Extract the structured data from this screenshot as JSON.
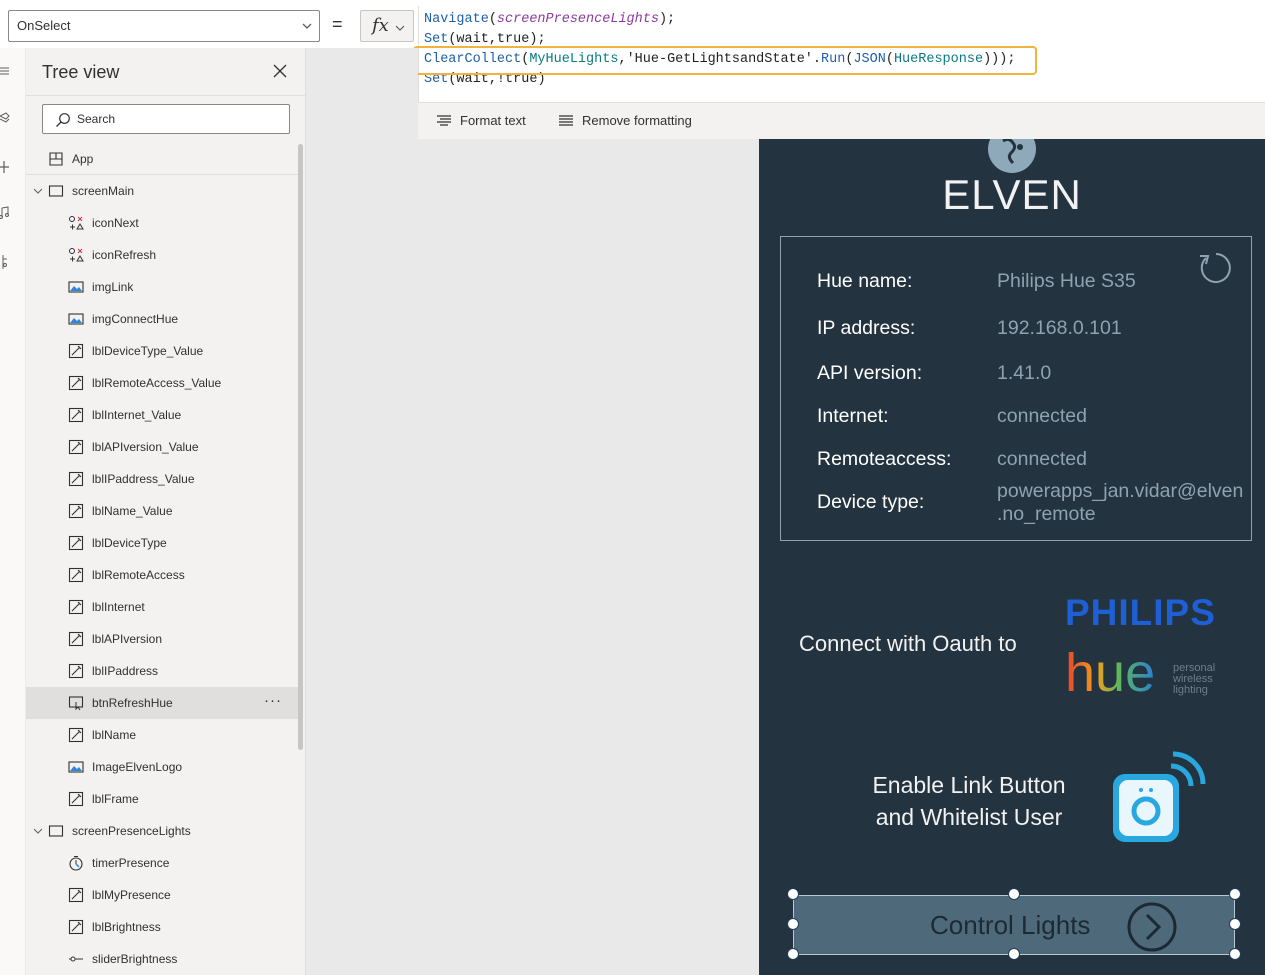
{
  "property_select": {
    "value": "OnSelect"
  },
  "equals": "=",
  "fx_label": "fx",
  "formula": {
    "lines": [
      "Navigate(screenPresenceLights);",
      "Set(wait,true);",
      "ClearCollect(MyHueLights,'Hue-GetLightsandState'.Run(JSON(HueResponse)));",
      "Set(wait,!true)"
    ],
    "line1": {
      "fn": "Navigate",
      "open": "(",
      "arg": "screenPresenceLights",
      "close": ");"
    },
    "line2": {
      "fn": "Set",
      "open": "(",
      "arg": "wait,true",
      "close": ");"
    },
    "line3": {
      "fn": "ClearCollect",
      "open": "(",
      "arg1": "MyHueLights",
      "sep": ",",
      "str": "'Hue-GetLightsandState'",
      "dot": ".",
      "fn2": "Run",
      "open2": "(",
      "fn3": "JSON",
      "open3": "(",
      "arg2": "HueResponse",
      "close": ")));"
    },
    "line4": {
      "fn": "Set",
      "open": "(",
      "arg": "wait,!true",
      "close": ")"
    }
  },
  "format_bar": {
    "format_text": "Format text",
    "remove_formatting": "Remove formatting"
  },
  "tree_view": {
    "title": "Tree view",
    "search_placeholder": "Search",
    "items": [
      {
        "label": "App",
        "icon": "app-icon",
        "level": 0
      },
      {
        "label": "screenMain",
        "icon": "screen-icon",
        "level": 0,
        "expanded": true
      },
      {
        "label": "iconNext",
        "icon": "icon-control-icon",
        "level": 1
      },
      {
        "label": "iconRefresh",
        "icon": "icon-control-icon",
        "level": 1
      },
      {
        "label": "imgLink",
        "icon": "image-icon",
        "level": 1
      },
      {
        "label": "imgConnectHue",
        "icon": "image-icon",
        "level": 1
      },
      {
        "label": "lblDeviceType_Value",
        "icon": "label-icon",
        "level": 1
      },
      {
        "label": "lblRemoteAccess_Value",
        "icon": "label-icon",
        "level": 1
      },
      {
        "label": "lblInternet_Value",
        "icon": "label-icon",
        "level": 1
      },
      {
        "label": "lblAPIversion_Value",
        "icon": "label-icon",
        "level": 1
      },
      {
        "label": "lblIPaddress_Value",
        "icon": "label-icon",
        "level": 1
      },
      {
        "label": "lblName_Value",
        "icon": "label-icon",
        "level": 1
      },
      {
        "label": "lblDeviceType",
        "icon": "label-icon",
        "level": 1
      },
      {
        "label": "lblRemoteAccess",
        "icon": "label-icon",
        "level": 1
      },
      {
        "label": "lblInternet",
        "icon": "label-icon",
        "level": 1
      },
      {
        "label": "lblAPIversion",
        "icon": "label-icon",
        "level": 1
      },
      {
        "label": "lblIPaddress",
        "icon": "label-icon",
        "level": 1
      },
      {
        "label": "btnRefreshHue",
        "icon": "button-icon",
        "level": 1,
        "selected": true
      },
      {
        "label": "lblName",
        "icon": "label-icon",
        "level": 1
      },
      {
        "label": "ImageElvenLogo",
        "icon": "image-icon",
        "level": 1
      },
      {
        "label": "lblFrame",
        "icon": "label-icon",
        "level": 1
      },
      {
        "label": "screenPresenceLights",
        "icon": "screen-icon",
        "level": 0,
        "expanded": true
      },
      {
        "label": "timerPresence",
        "icon": "timer-icon",
        "level": 1
      },
      {
        "label": "lblMyPresence",
        "icon": "label-icon",
        "level": 1
      },
      {
        "label": "lblBrightness",
        "icon": "label-icon",
        "level": 1
      },
      {
        "label": "sliderBrightness",
        "icon": "slider-icon",
        "level": 1
      }
    ],
    "more_label": "···"
  },
  "app_screen": {
    "logo_text": "ELVEN",
    "info": [
      {
        "label": "Hue name:",
        "value": "Philips Hue S35"
      },
      {
        "label": "IP address:",
        "value": "192.168.0.101"
      },
      {
        "label": "API version:",
        "value": "1.41.0"
      },
      {
        "label": "Internet:",
        "value": "connected"
      },
      {
        "label": "Remoteaccess:",
        "value": "connected"
      },
      {
        "label": "Device type:",
        "value": "powerapps_jan.vidar@elven.no_remote"
      }
    ],
    "device_type_line1": "powerapps_jan.vidar@elven",
    "device_type_line2": ".no_remote",
    "oauth_text": "Connect with Oauth to",
    "philips_logo": "PHILIPS",
    "hue_logo": "hue",
    "hue_tagline": [
      "personal",
      "wireless",
      "lighting"
    ],
    "link_text_line1": "Enable Link Button",
    "link_text_line2": "and Whitelist User",
    "control_button": "Control Lights"
  },
  "colors": {
    "app_bg": "#23333f",
    "value_text": "#8da3b1",
    "highlight_box": "#f2b33d",
    "philips_blue": "#1e5fd6",
    "bridge_blue": "#29a8e0",
    "button_bg": "#4e6a7a"
  }
}
